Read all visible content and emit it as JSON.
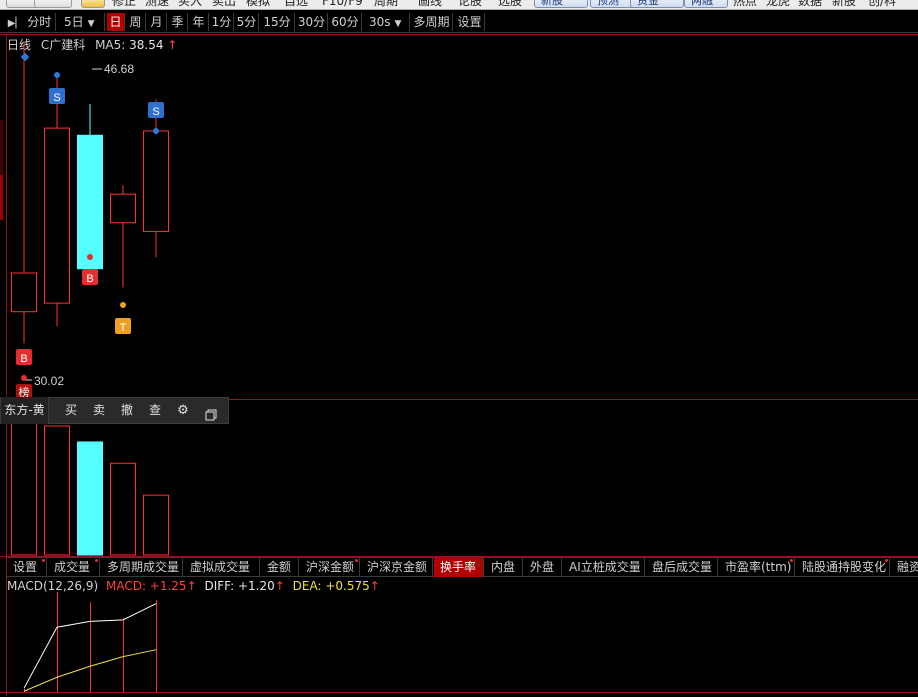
{
  "top_menu": {
    "items": [
      "修正",
      "测速",
      "买入",
      "卖出",
      "模拟",
      "自选",
      "F10/F9",
      "周期",
      "画线",
      "论股",
      "选股"
    ],
    "tabs": [
      "新股",
      "预测",
      "资金",
      "两融"
    ],
    "right_items": [
      "热点",
      "龙虎",
      "数据",
      "新股",
      "创/科"
    ]
  },
  "period_bar": {
    "items": [
      "分时",
      "5日",
      "日",
      "周",
      "月",
      "季",
      "年",
      "1分",
      "5分",
      "15分",
      "30分",
      "60分",
      "30s",
      "多周期",
      "设置"
    ],
    "active": "日"
  },
  "main_chart": {
    "period_label": "日线",
    "stock_name": "C广建科",
    "ma_label": "MA5:",
    "ma_value": "38.54",
    "ma_arrow": "↑",
    "high_label": "46.68",
    "low_label": "30.02",
    "markers": {
      "b1": "B",
      "s1": "S",
      "b2": "B",
      "t1": "T",
      "s2": "S",
      "bang": "榜"
    },
    "colors": {
      "up": "#ff3232",
      "down": "#54ffff",
      "marker_blue": "#2f6fd0",
      "marker_red": "#e03030",
      "marker_orange": "#f0a020"
    }
  },
  "chart_data": {
    "type": "candlestick",
    "candles": [
      {
        "open": 32.2,
        "close": 34.9,
        "high": 51.0,
        "low": 30.0
      },
      {
        "open": 32.8,
        "close": 45.0,
        "high": 48.6,
        "low": 31.2
      },
      {
        "open": 44.5,
        "close": 35.2,
        "high": 46.68,
        "low": 35.2
      },
      {
        "open": 38.4,
        "close": 40.4,
        "high": 41.0,
        "low": 33.9
      },
      {
        "open": 37.8,
        "close": 44.8,
        "high": 47.0,
        "low": 36.0
      }
    ],
    "volume": [
      1.0,
      0.97,
      0.85,
      0.69,
      0.45
    ]
  },
  "trade_bar": {
    "account": "东方-黄",
    "buy": "买",
    "sell": "卖",
    "cancel": "撤",
    "query": "查"
  },
  "indicator_tabs": {
    "items": [
      "设置",
      "成交量",
      "多周期成交量",
      "虚拟成交量",
      "金额",
      "沪深金额",
      "沪深京金额",
      "换手率",
      "内盘",
      "外盘",
      "AI立桩成交量",
      "盘后成交量",
      "市盈率(ttm)",
      "陆股通持股变化",
      "融资"
    ],
    "active": "换手率",
    "dotted": [
      "成交量",
      "沪深金额",
      "市盈率(ttm)",
      "陆股通持股变化"
    ]
  },
  "macd": {
    "name": "MACD(12,26,9)",
    "macd_label": "MACD: +1.25",
    "macd_arrow": "↑",
    "diff_label": "DIFF: +1.20",
    "diff_arrow": "↑",
    "dea_label": "DEA: +0.575",
    "dea_arrow": "↑",
    "diff_series": [
      0.05,
      0.88,
      0.96,
      0.98,
      1.2
    ],
    "dea_series": [
      0.01,
      0.2,
      0.35,
      0.48,
      0.575
    ],
    "bars": [
      0.04,
      1.36,
      1.22,
      1.0,
      1.25
    ]
  }
}
